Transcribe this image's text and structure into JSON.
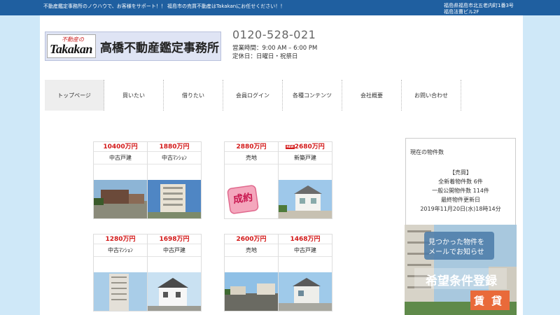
{
  "topbar": {
    "tagline": "不動産鑑定事務所のノウハウで、お客様をサポート！！ 福島市の売買不動産はTakakanにお任せください！！",
    "address_line1": "福島県福島市北五老内町1番3号",
    "address_line2": "福島法曹ビル2F"
  },
  "header": {
    "logo_small": "不動産の",
    "logo_en": "Takakan",
    "company_name": "高橋不動産鑑定事務所",
    "phone": "0120-528-021",
    "hours": "営業時間：9:00 AM – 6:00 PM",
    "holidays": "定休日：日曜日・祝祭日"
  },
  "nav": {
    "items": [
      {
        "label": "トップページ"
      },
      {
        "label": "買いたい"
      },
      {
        "label": "借りたい"
      },
      {
        "label": "会員ログイン"
      },
      {
        "label": "各種コンテンツ"
      },
      {
        "label": "会社概要"
      },
      {
        "label": "お問い合わせ"
      }
    ]
  },
  "listings": [
    {
      "price": "10400万円",
      "type": "中古戸建"
    },
    {
      "price": "1880万円",
      "type": "中古ﾏﾝｼｮﾝ"
    },
    {
      "price": "2880万円",
      "type": "売地",
      "stamp": "成約"
    },
    {
      "price": "2680万円",
      "type": "新築戸建",
      "new_tag": "NEW"
    },
    {
      "price": "1280万円",
      "type": "中古ﾏﾝｼｮﾝ"
    },
    {
      "price": "1698万円",
      "type": "中古戸建"
    },
    {
      "price": "2600万円",
      "type": "売地"
    },
    {
      "price": "1468万円",
      "type": "中古戸建"
    }
  ],
  "sidebar": {
    "title": "現在の物件数",
    "section": "【売買】",
    "new_count": "全新着物件数 6件",
    "public_count": "一般公開物件数 114件",
    "updated_label": "最終物件更新日",
    "updated_date": "2019年11月20日(水)18時14分"
  },
  "banner": {
    "line1": "見つかった物件を",
    "line2": "メールでお知らせ",
    "title": "希望条件登録",
    "tag1": "賃",
    "tag2": "貸"
  },
  "colors": {
    "topbar": "#1f5fa0",
    "background": "#cfe8f8",
    "price": "#d31919"
  }
}
